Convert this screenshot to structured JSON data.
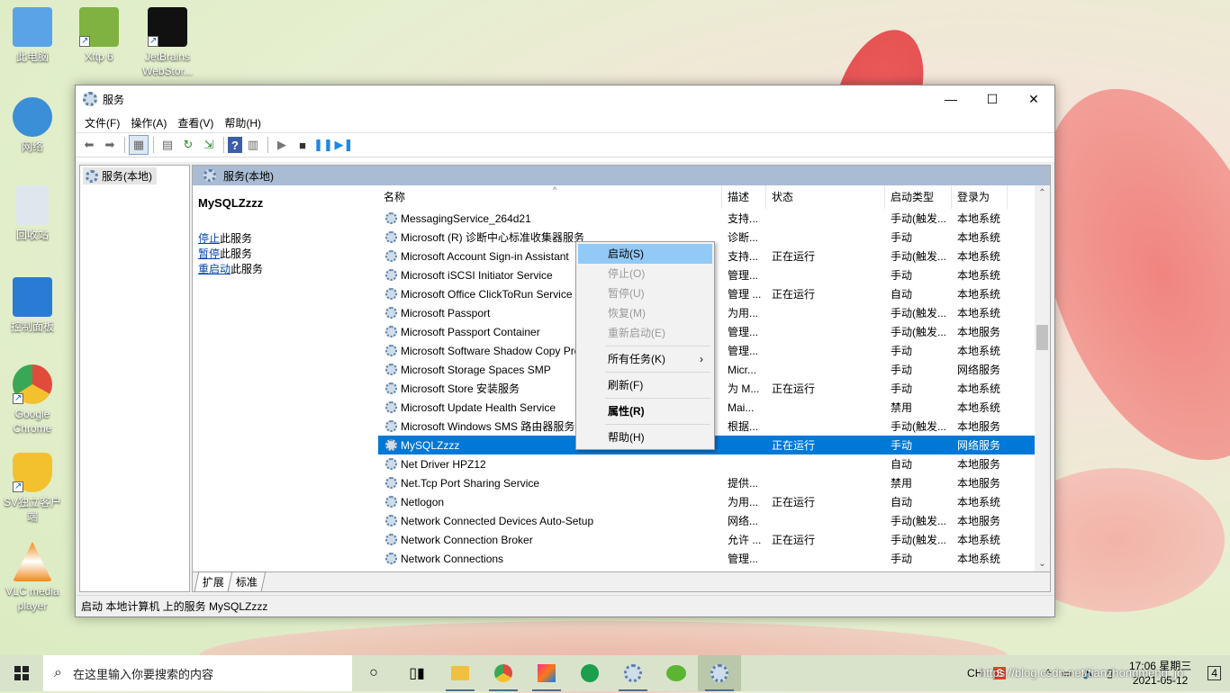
{
  "desktop": {
    "icons": [
      {
        "label": "此电脑",
        "color": "#5aa3e6"
      },
      {
        "label": "Xftp 6",
        "color": "#7fb240"
      },
      {
        "label": "JetBrains WebStor...",
        "color": "#111111"
      },
      {
        "label": "网络",
        "color": "#3a8fd6"
      },
      {
        "label": "回收站",
        "color": "#e0e6ee"
      },
      {
        "label": "控制面板",
        "color": "#2a7bd4"
      },
      {
        "label": "Google Chrome",
        "color": "#e04b3c"
      },
      {
        "label": "SV独立客户端",
        "color": "#f3c12e"
      },
      {
        "label": "VLC media player",
        "color": "#f08a1c"
      }
    ]
  },
  "window": {
    "title": "服务",
    "controls": {
      "minimize": "—",
      "maximize": "☐",
      "close": "✕"
    },
    "menu": [
      "文件(F)",
      "操作(A)",
      "查看(V)",
      "帮助(H)"
    ],
    "tree": {
      "root": "服务(本地)"
    },
    "panel_header": "服务(本地)",
    "selected_service": {
      "name": "MySQLZzzz",
      "links": [
        {
          "link": "停止",
          "rest": "此服务"
        },
        {
          "link": "暂停",
          "rest": "此服务"
        },
        {
          "link": "重启动",
          "rest": "此服务"
        }
      ]
    },
    "columns": [
      "名称",
      "描述",
      "状态",
      "启动类型",
      "登录为"
    ],
    "rows": [
      {
        "name": "MessagingService_264d21",
        "desc": "支持...",
        "status": "",
        "start": "手动(触发...",
        "logon": "本地系统"
      },
      {
        "name": "Microsoft (R) 诊断中心标准收集器服务",
        "desc": "诊断...",
        "status": "",
        "start": "手动",
        "logon": "本地系统"
      },
      {
        "name": "Microsoft Account Sign-in Assistant",
        "desc": "支持...",
        "status": "正在运行",
        "start": "手动(触发...",
        "logon": "本地系统"
      },
      {
        "name": "Microsoft iSCSI Initiator Service",
        "desc": "管理...",
        "status": "",
        "start": "手动",
        "logon": "本地系统"
      },
      {
        "name": "Microsoft Office ClickToRun Service",
        "desc": "管理 ...",
        "status": "正在运行",
        "start": "自动",
        "logon": "本地系统"
      },
      {
        "name": "Microsoft Passport",
        "desc": "为用...",
        "status": "",
        "start": "手动(触发...",
        "logon": "本地系统"
      },
      {
        "name": "Microsoft Passport Container",
        "desc": "管理...",
        "status": "",
        "start": "手动(触发...",
        "logon": "本地服务"
      },
      {
        "name": "Microsoft Software Shadow Copy Provider",
        "desc": "管理...",
        "status": "",
        "start": "手动",
        "logon": "本地系统"
      },
      {
        "name": "Microsoft Storage Spaces SMP",
        "desc": "Micr...",
        "status": "",
        "start": "手动",
        "logon": "网络服务"
      },
      {
        "name": "Microsoft Store 安装服务",
        "desc": "为 M...",
        "status": "正在运行",
        "start": "手动",
        "logon": "本地系统"
      },
      {
        "name": "Microsoft Update Health Service",
        "desc": "Mai...",
        "status": "",
        "start": "禁用",
        "logon": "本地系统"
      },
      {
        "name": "Microsoft Windows SMS 路由器服务",
        "desc": "根据...",
        "status": "",
        "start": "手动(触发...",
        "logon": "本地服务"
      },
      {
        "name": "MySQLZzzz",
        "desc": "",
        "status": "正在运行",
        "start": "手动",
        "logon": "网络服务",
        "selected": true
      },
      {
        "name": "Net Driver HPZ12",
        "desc": "",
        "status": "",
        "start": "自动",
        "logon": "本地服务"
      },
      {
        "name": "Net.Tcp Port Sharing Service",
        "desc": "提供...",
        "status": "",
        "start": "禁用",
        "logon": "本地服务"
      },
      {
        "name": "Netlogon",
        "desc": "为用...",
        "status": "正在运行",
        "start": "自动",
        "logon": "本地系统"
      },
      {
        "name": "Network Connected Devices Auto-Setup",
        "desc": "网络...",
        "status": "",
        "start": "手动(触发...",
        "logon": "本地服务"
      },
      {
        "name": "Network Connection Broker",
        "desc": "允许 ...",
        "status": "正在运行",
        "start": "手动(触发...",
        "logon": "本地系统"
      },
      {
        "name": "Network Connections",
        "desc": "管理...",
        "status": "",
        "start": "手动",
        "logon": "本地系统"
      }
    ],
    "tabs": [
      "扩展",
      "标准"
    ],
    "statusbar": "启动 本地计算机 上的服务 MySQLZzzz"
  },
  "context_menu": {
    "items": [
      {
        "label": "启动(S)",
        "state": "highlighted"
      },
      {
        "label": "停止(O)",
        "state": "disabled"
      },
      {
        "label": "暂停(U)",
        "state": "disabled"
      },
      {
        "label": "恢复(M)",
        "state": "disabled"
      },
      {
        "label": "重新启动(E)",
        "state": "disabled"
      },
      {
        "sep": true
      },
      {
        "label": "所有任务(K)",
        "state": "normal",
        "submenu": true
      },
      {
        "sep": true
      },
      {
        "label": "刷新(F)",
        "state": "normal"
      },
      {
        "sep": true
      },
      {
        "label": "属性(R)",
        "state": "bold"
      },
      {
        "sep": true
      },
      {
        "label": "帮助(H)",
        "state": "normal"
      }
    ]
  },
  "taskbar": {
    "search_placeholder": "在这里输入你要搜索的内容",
    "apps": [
      "task-view",
      "multitask",
      "file-explorer",
      "chrome",
      "intellij",
      "evernote",
      "services-gear",
      "wechat",
      "services-active"
    ],
    "tray": {
      "lang": "CH",
      "ime": "S",
      "chevron": "^"
    },
    "time": "17:06 星期三",
    "date": "2021-05-12",
    "notification_count": "4"
  },
  "watermark": "https://blog.csdn.net/tianzhongmeng_jo",
  "colors": {
    "selection": "#0078d7",
    "menu_highlight": "#91c9f7",
    "panel_header": "#a9bcd3"
  }
}
